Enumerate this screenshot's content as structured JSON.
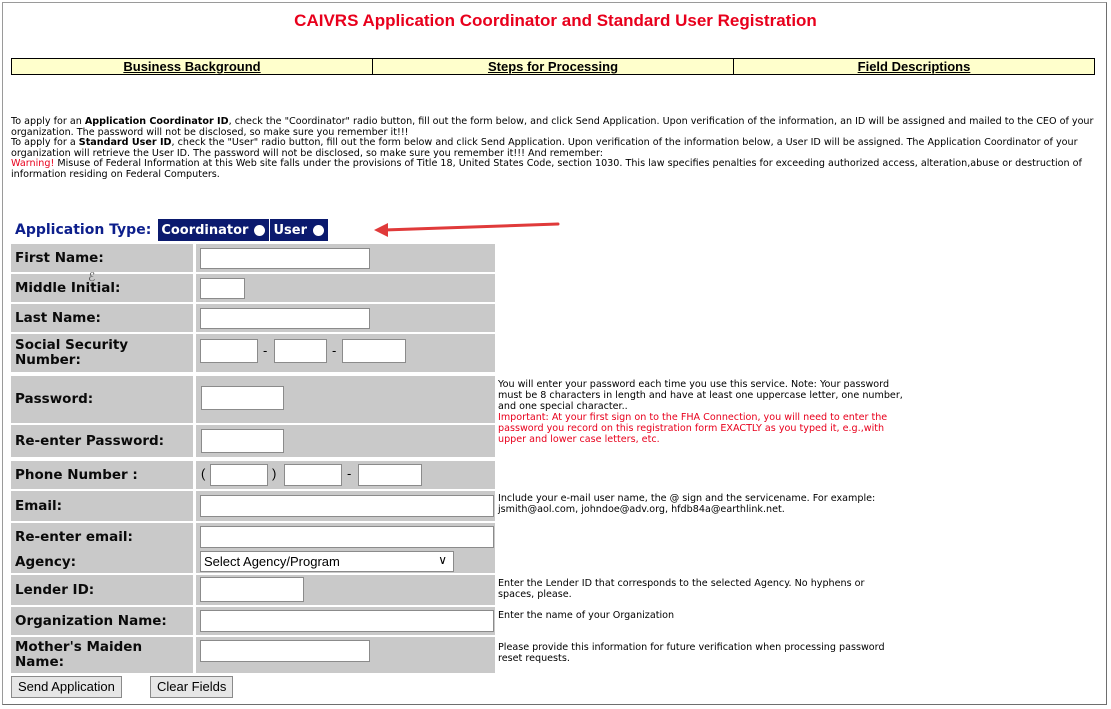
{
  "page": {
    "title": "CAIVRS Application Coordinator and Standard User Registration"
  },
  "nav": [
    {
      "label": "Business Background"
    },
    {
      "label": "Steps for Processing"
    },
    {
      "label": "Field Descriptions"
    }
  ],
  "intro": {
    "p1_a": "To apply for an ",
    "p1_b": "Application Coordinator ID",
    "p1_c": ", check the \"Coordinator\" radio button, fill out the form below, and click Send Application. Upon verification of the information, an ID will be assigned and mailed to the CEO of your organization. The password will not be disclosed, so make sure you remember it!!!",
    "p2_a": "To apply for a ",
    "p2_b": "Standard User ID",
    "p2_c": ", check the \"User\" radio button, fill out the form below and click Send Application. Upon verification of the information below, a User ID will be assigned. The Application Coordinator of your organization will retrieve the User ID. The password will not be disclosed, so make sure you remember it!!! And remember:",
    "warn_label": "Warning!",
    "warn_text": " Misuse of Federal Information at this Web site falls under the provisions of Title 18, United States Code, section 1030. This law specifies penalties for exceeding authorized access, alteration,abuse or destruction of information residing on Federal Computers."
  },
  "application_type": {
    "label": "Application Type:",
    "options": [
      "Coordinator",
      "User"
    ]
  },
  "fields": {
    "first_name": "First Name:",
    "middle_initial": "Middle Initial:",
    "last_name": "Last Name:",
    "ssn": "Social Security Number:",
    "password": "Password:",
    "reenter_password": "Re-enter Password:",
    "phone": "Phone Number :",
    "email": "Email:",
    "reenter_email": "Re-enter email:",
    "agency": "Agency:",
    "lender_id": "Lender ID:",
    "org_name": "Organization Name:",
    "maiden_name": "Mother's Maiden Name:"
  },
  "separators": {
    "dash": "-",
    "paren_open": "(",
    "paren_close": ")"
  },
  "agency_select": {
    "selected": "Select Agency/Program"
  },
  "help": {
    "password_1": "You will enter your password each time you use this service. Note: Your password must be 8 characters in length and have at least one uppercase letter, one number, and one special character..",
    "password_2": "Important: At your first sign on to the FHA Connection, you will need to enter the password you record on this registration form EXACTLY as you typed it, e.g.,with upper and lower case letters, etc.",
    "email": "Include your e-mail user name, the @ sign and the servicename. For example: jsmith@aol.com, johndoe@adv.org, hfdb84a@earthlink.net.",
    "lender": "Enter the Lender ID that corresponds to the selected Agency. No hyphens or spaces, please.",
    "org": "Enter the name of your Organization",
    "maiden": "Please provide this information for future verification when processing password reset requests."
  },
  "buttons": {
    "send": "Send Application",
    "clear": "Clear Fields"
  },
  "colors": {
    "title": "#e8001c",
    "nav_bg": "#ffffcc",
    "label_bg": "#c9c9c9",
    "radio_bg": "#0b1a6e",
    "apptype_text": "#0d1f8c"
  }
}
